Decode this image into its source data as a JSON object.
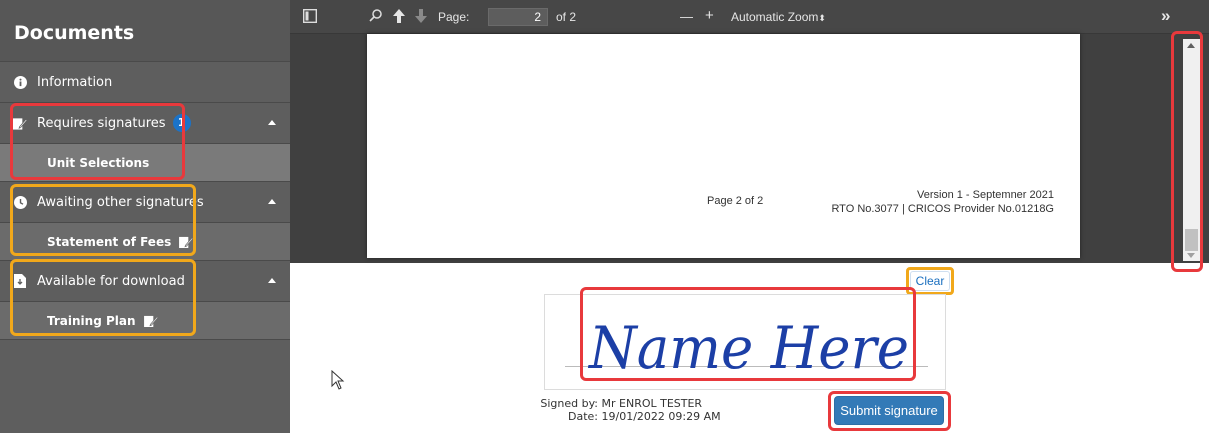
{
  "sidebar": {
    "title": "Documents",
    "information": "Information",
    "requires": {
      "label": "Requires signatures",
      "count": "1",
      "items": [
        "Unit Selections"
      ]
    },
    "awaiting": {
      "label": "Awaiting other signatures",
      "items": [
        "Statement of Fees"
      ]
    },
    "download": {
      "label": "Available for download",
      "items": [
        "Training Plan"
      ]
    }
  },
  "toolbar": {
    "page_label": "Page:",
    "page_value": "2",
    "page_of": "of 2",
    "zoom_minus": "—",
    "zoom_plus": "+",
    "zoom": "Automatic Zoom",
    "more": "»"
  },
  "pdf": {
    "footer_center": "Page 2 of 2",
    "version": "Version 1 - Septemner 2021",
    "rto": "RTO No.3077 | CRICOS Provider No.01218G"
  },
  "signature": {
    "clear": "Clear",
    "handwriting": "Name Here",
    "signed_by_label": "Signed by:",
    "signed_by": "Mr ENROL TESTER",
    "date_label": "Date:",
    "date": "19/01/2022 09:29 AM",
    "submit": "Submit signature"
  },
  "colors": {
    "accent": "#337ab7",
    "badge": "#1a73c9",
    "highlight_red": "#e8393c",
    "highlight_orange": "#f1a81b",
    "sidebar_bg": "#5e5e5e"
  }
}
